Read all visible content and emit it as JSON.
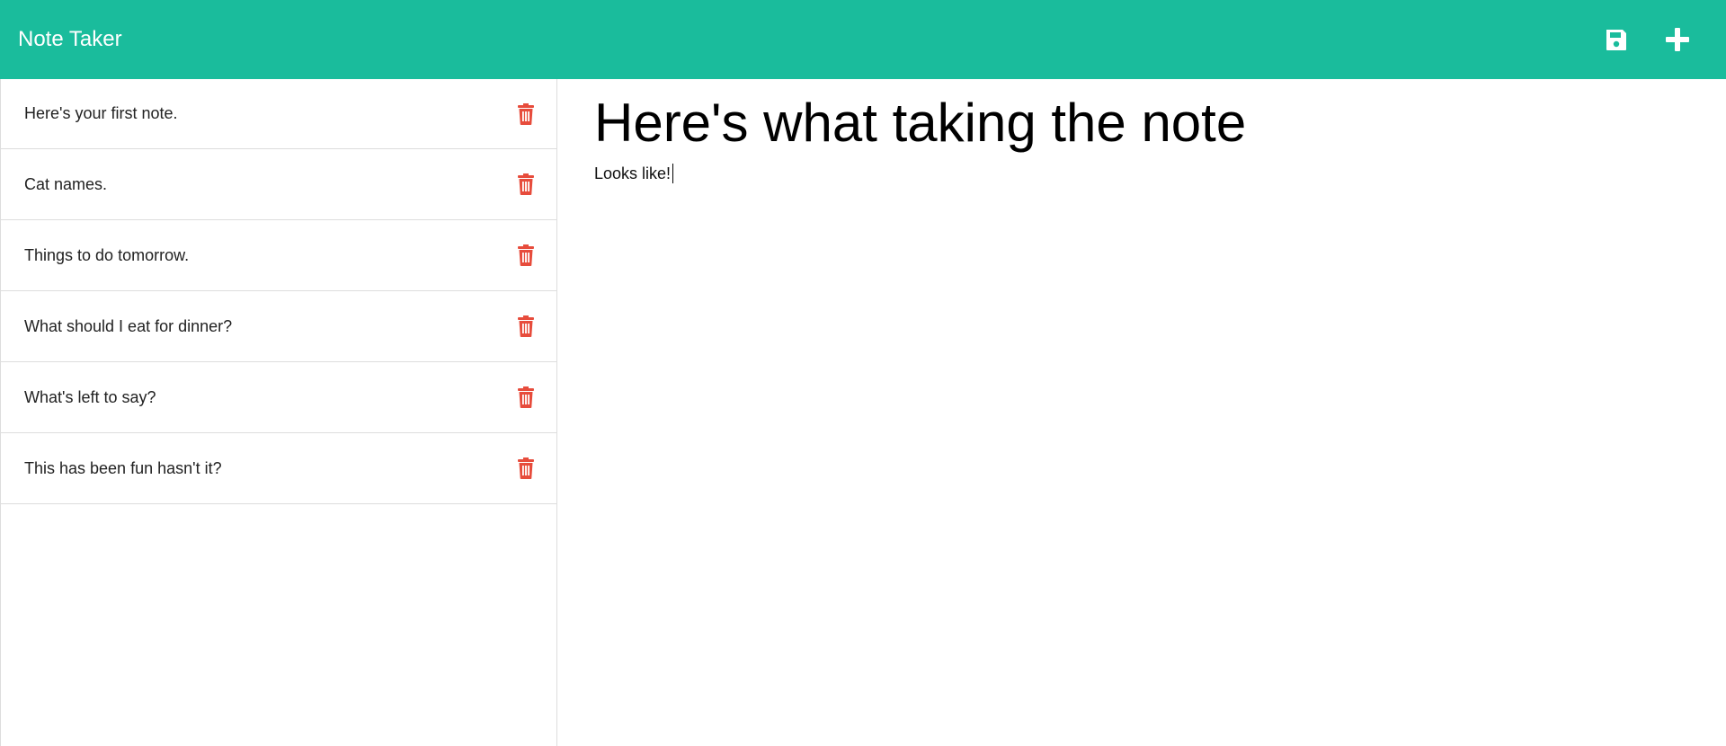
{
  "navbar": {
    "title": "Note Taker",
    "save_icon": "save-icon",
    "add_icon": "plus-icon",
    "color": "#1abc9c"
  },
  "notes": [
    {
      "title": "Here's your first note."
    },
    {
      "title": "Cat names."
    },
    {
      "title": "Things to do tomorrow."
    },
    {
      "title": "What should I eat for dinner?"
    },
    {
      "title": "What's left to say?"
    },
    {
      "title": "This has been fun hasn't it?"
    }
  ],
  "editor": {
    "title": "Here's what taking the note",
    "body": "Looks like!"
  },
  "colors": {
    "accent": "#1abc9c",
    "delete": "#e74c3c"
  }
}
